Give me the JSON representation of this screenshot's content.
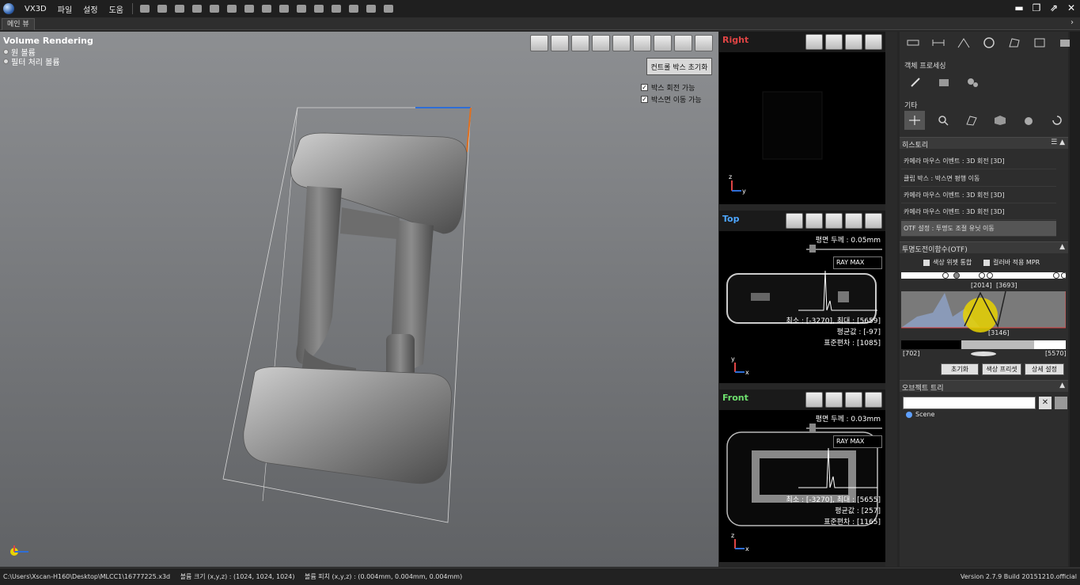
{
  "app": {
    "name": "VX3D"
  },
  "menu": [
    "파일",
    "설정",
    "도움"
  ],
  "toolbar_icons": [
    "undo-icon",
    "redo-icon",
    "open-icon",
    "import-icon",
    "save-icon",
    "measure-icon",
    "globe-icon",
    "camera-icon",
    "sphere-icon",
    "layers-icon",
    "grid-icon",
    "dots-icon",
    "export-icon",
    "print-icon",
    "document-icon"
  ],
  "tabs": [
    {
      "label": "메인 뷰"
    }
  ],
  "view3d": {
    "title": "Volume Rendering",
    "volumes": [
      "원 볼륨",
      "필터 처리 볼륨"
    ],
    "reset_box_label": "컨트롤 박스 초기화",
    "checks": [
      {
        "label": "박스 회전 가능",
        "checked": true
      },
      {
        "label": "박스면 이동 가능",
        "checked": true
      }
    ]
  },
  "slices": {
    "right": {
      "title": "Right"
    },
    "top": {
      "title": "Top",
      "plane_thickness": "평면 두께 : 0.05mm",
      "mode": "RAY MAX",
      "stats": {
        "minmax": "최소 : [-3270], 최대 : [5659]",
        "mean": "평균값 : [-97]",
        "std": "표준편차 : [1085]"
      }
    },
    "front": {
      "title": "Front",
      "plane_thickness": "평면 두께 : 0.03mm",
      "mode": "RAY MAX",
      "stats": {
        "minmax": "최소 : [-3270], 최대 : [5655]",
        "mean": "평균값 : [257]",
        "std": "표준편차 : [1165]"
      }
    }
  },
  "panel": {
    "object_processing": "객체 프로세싱",
    "etc": "기타",
    "history_title": "히스토리",
    "history": [
      "카메라 마우스 이벤트 : 3D 회전 [3D]",
      "클립 박스 : 박스면 평행 이동",
      "카메라 마우스 이벤트 : 3D 회전 [3D]",
      "카메라 마우스 이벤트 : 3D 회전 [3D]",
      "OTF 설정 : 투명도 조절 유닛 이동"
    ],
    "otf_title": "투명도전이함수(OTF)",
    "otf_check1": "색상 위젯 통합",
    "otf_check2": "컬러바 적용 MPR",
    "otf_labels": {
      "a": "[2014]",
      "b": "[3693]",
      "c": "[3146]",
      "left": "[702]",
      "right": "[5570]"
    },
    "otf_buttons": [
      "초기화",
      "색상 프리셋",
      "상세 설정"
    ],
    "object_tree_title": "오브젝트 트리",
    "tree_root": "Scene"
  },
  "status": {
    "path": "C:\\Users\\Xscan-H160\\Desktop\\MLCC1\\16777225.x3d",
    "volume_size": "볼륨 크기 (x,y,z) : (1024, 1024, 1024)",
    "volume_pitch": "볼륨 피치 (x,y,z) : (0.004mm, 0.004mm, 0.004mm)",
    "version": "Version 2.7.9 Build 20151210.official"
  },
  "colors": {
    "accent_red": "#e04444",
    "axis_blue": "#2e6ed6",
    "highlight_yellow": "#e8d200"
  }
}
